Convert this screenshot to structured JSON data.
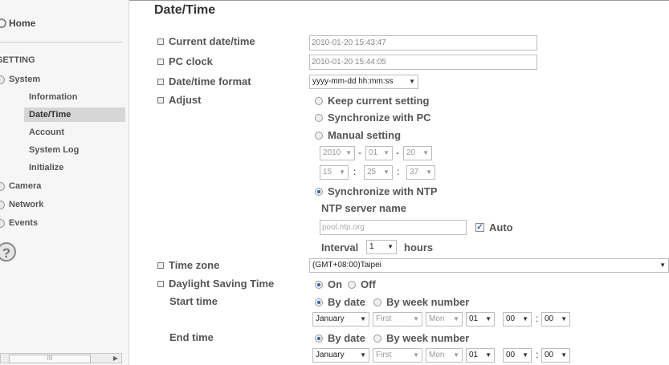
{
  "sidebar": {
    "home": "Home",
    "setting": "SETTING",
    "system": "System",
    "system_items": [
      "Information",
      "Date/Time",
      "Account",
      "System Log",
      "Initialize"
    ],
    "camera": "Camera",
    "network": "Network",
    "events": "Events",
    "help": "?",
    "scroll_thumb": "III"
  },
  "page": {
    "title": "Date/Time"
  },
  "form": {
    "current_label": "Current date/time",
    "current_value": "2010-01-20   15:43:47",
    "pc_label": "PC clock",
    "pc_value": "2010-01-20   15:44:05",
    "format_label": "Date/time format",
    "format_value": "yyyy-mm-dd hh:mm:ss",
    "adjust_label": "Adjust",
    "opt_keep": "Keep current setting",
    "opt_sync_pc": "Synchronize with PC",
    "opt_manual": "Manual setting",
    "year": "2010",
    "month": "01",
    "day": "20",
    "hour": "15",
    "minute": "25",
    "second": "37",
    "dash": "-",
    "colon": ":",
    "opt_ntp": "Synchronize with NTP",
    "ntp_label": "NTP server name",
    "ntp_placeholder": "pool.ntp.org",
    "auto_label": "Auto",
    "interval_label": "Interval",
    "interval_value": "1",
    "hours_label": "hours",
    "tz_label": "Time zone",
    "tz_value": "(GMT+08:00)Taipei",
    "dst_label": "Daylight Saving Time",
    "on": "On",
    "off": "Off",
    "start_label": "Start time",
    "end_label": "End time",
    "by_date": "By date",
    "by_week": "By week number",
    "start": {
      "month": "January",
      "week": "First",
      "weekday": "Mon",
      "day": "01",
      "hour": "00",
      "minute": "00"
    },
    "end": {
      "month": "January",
      "week": "First",
      "weekday": "Mon",
      "day": "01",
      "hour": "00",
      "minute": "00"
    }
  },
  "colors": {
    "accent": "#2d5fa8",
    "sidebar_bg": "#f6f6f6",
    "active_bg": "#d6d6d6"
  }
}
